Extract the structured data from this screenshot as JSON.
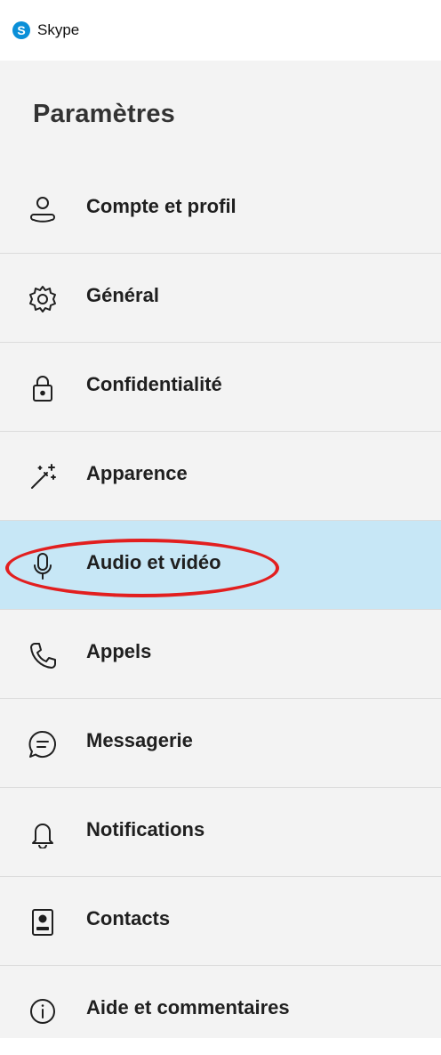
{
  "app": {
    "title": "Skype",
    "logo_letter": "S"
  },
  "settings": {
    "title": "Paramètres",
    "items": [
      {
        "label": "Compte et profil",
        "icon": "user-icon"
      },
      {
        "label": "Général",
        "icon": "gear-icon"
      },
      {
        "label": "Confidentialité",
        "icon": "lock-icon"
      },
      {
        "label": "Apparence",
        "icon": "magic-wand-icon"
      },
      {
        "label": "Audio et vidéo",
        "icon": "microphone-icon",
        "selected": true
      },
      {
        "label": "Appels",
        "icon": "phone-icon"
      },
      {
        "label": "Messagerie",
        "icon": "chat-bubble-icon"
      },
      {
        "label": "Notifications",
        "icon": "bell-icon"
      },
      {
        "label": "Contacts",
        "icon": "contact-card-icon"
      },
      {
        "label": "Aide et commentaires",
        "icon": "info-icon"
      }
    ]
  },
  "colors": {
    "accent": "#0a8fd8",
    "selected_background": "#c7e7f6",
    "highlight_ellipse": "#e21f1f"
  }
}
